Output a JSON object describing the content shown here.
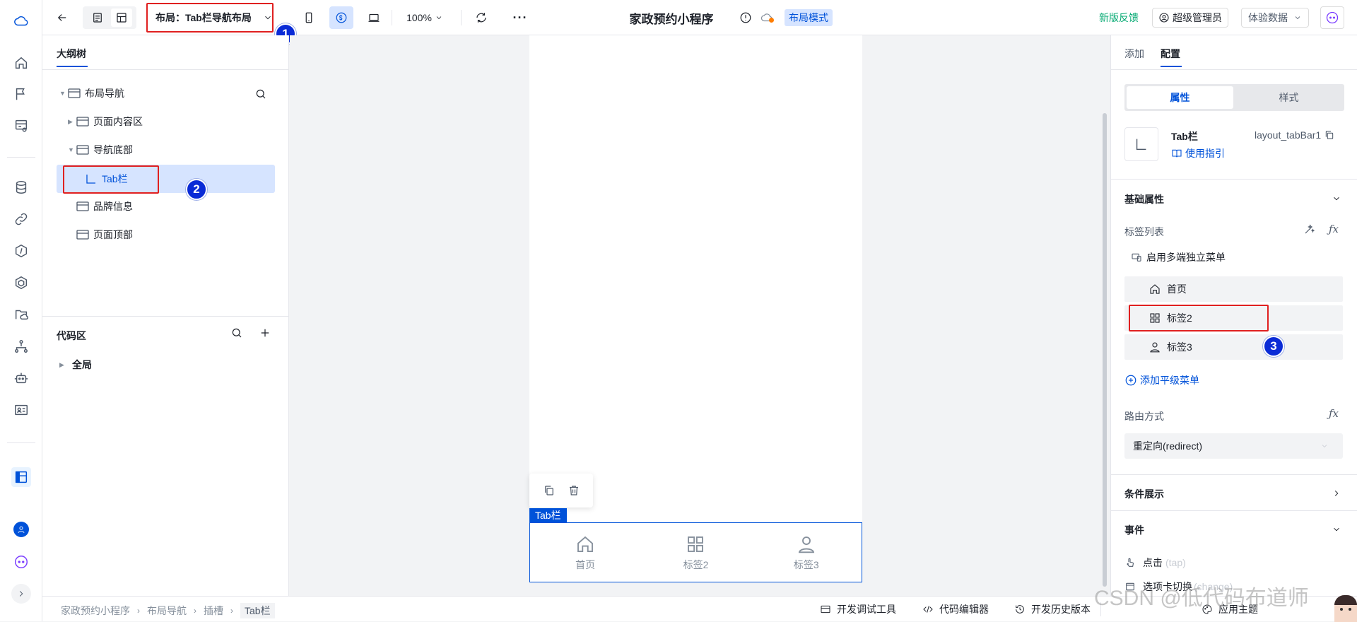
{
  "app": {
    "title": "家政预约小程序",
    "mode_badge": "布局模式",
    "layout_selector": "布局：Tab栏导航布局",
    "zoom": "100%",
    "feedback_link": "新版反馈",
    "user_role": "超级管理员",
    "data_selector": "体验数据",
    "accent": "#0052d9"
  },
  "markers": {
    "one": "1",
    "two": "2",
    "three": "3"
  },
  "outline": {
    "tab_label": "大纲树",
    "tree": {
      "root": "布局导航",
      "page_content": "页面内容区",
      "nav_bottom": "导航底部",
      "tabbar": "Tab栏",
      "brand": "品牌信息",
      "page_top": "页面顶部"
    },
    "code_area": {
      "title": "代码区",
      "global": "全局"
    }
  },
  "canvas": {
    "component_tag": "Tab栏",
    "tabs": [
      {
        "label": "首页",
        "icon": "home-icon"
      },
      {
        "label": "标签2",
        "icon": "grid-icon"
      },
      {
        "label": "标签3",
        "icon": "user-icon"
      }
    ]
  },
  "right": {
    "tabs": {
      "add": "添加",
      "config": "配置"
    },
    "segment": {
      "props": "属性",
      "style": "样式"
    },
    "component": {
      "name": "Tab栏",
      "id": "layout_tabBar1",
      "guide": "使用指引"
    },
    "basic": {
      "title": "基础属性",
      "tab_list_label": "标签列表",
      "multi_menu": "启用多端独立菜单",
      "items": [
        "首页",
        "标签2",
        "标签3"
      ],
      "add_menu": "添加平级菜单",
      "route_label": "路由方式",
      "route_value": "重定向(redirect)"
    },
    "condition": {
      "title": "条件展示"
    },
    "events": {
      "title": "事件",
      "tap": "点击",
      "tap_code": "(tap)",
      "change": "选项卡切换",
      "change_code": "(change)"
    }
  },
  "statusbar": {
    "breadcrumb": [
      "家政预约小程序",
      "布局导航",
      "插槽",
      "Tab栏"
    ],
    "dev_tools": "开发调试工具",
    "code_editor": "代码编辑器",
    "history": "开发历史版本",
    "theme": "应用主题"
  },
  "watermark": "CSDN @低代码布道师"
}
